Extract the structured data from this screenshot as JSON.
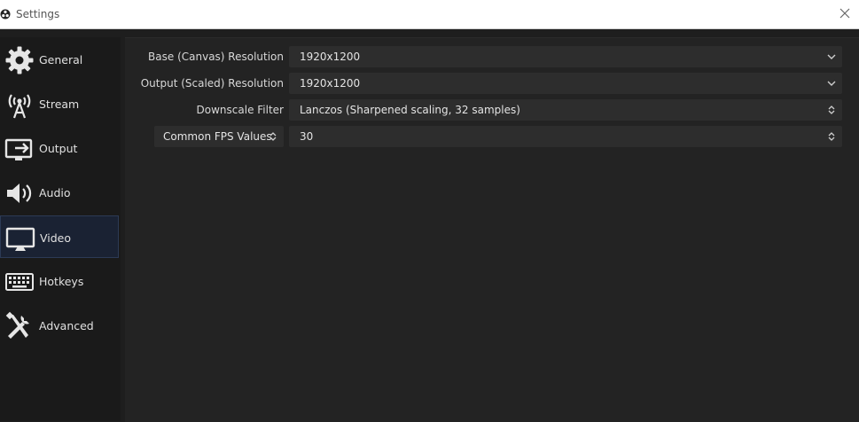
{
  "window": {
    "title": "Settings"
  },
  "sidebar": {
    "items": [
      {
        "label": "General",
        "icon": "gear-icon"
      },
      {
        "label": "Stream",
        "icon": "antenna-icon"
      },
      {
        "label": "Output",
        "icon": "output-icon"
      },
      {
        "label": "Audio",
        "icon": "speaker-icon"
      },
      {
        "label": "Video",
        "icon": "monitor-icon",
        "active": true
      },
      {
        "label": "Hotkeys",
        "icon": "keyboard-icon"
      },
      {
        "label": "Advanced",
        "icon": "tools-icon"
      }
    ]
  },
  "video": {
    "base_resolution": {
      "label": "Base (Canvas) Resolution",
      "value": "1920x1200"
    },
    "output_resolution": {
      "label": "Output (Scaled) Resolution",
      "value": "1920x1200"
    },
    "downscale_filter": {
      "label": "Downscale Filter",
      "value": "Lanczos (Sharpened scaling, 32 samples)"
    },
    "fps": {
      "type": "Common FPS Values",
      "value": "30"
    }
  },
  "colors": {
    "background": "#1e1e1e",
    "panel": "#232323",
    "field": "#2d2d2d",
    "active_item": "#1a2233"
  }
}
